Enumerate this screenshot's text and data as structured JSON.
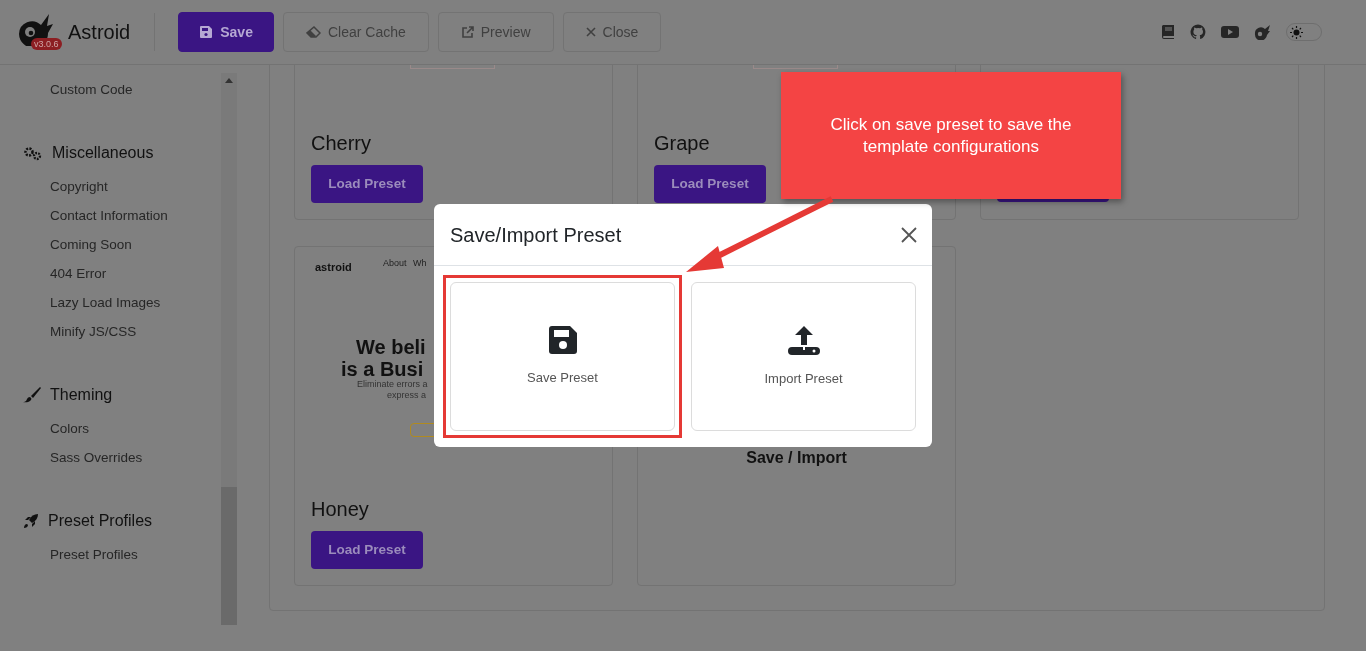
{
  "header": {
    "logo_text": "Astroid",
    "version": "v3.0.6",
    "buttons": [
      {
        "label": "Save",
        "kind": "primary"
      },
      {
        "label": "Clear Cache",
        "kind": "default"
      },
      {
        "label": "Preview",
        "kind": "default"
      },
      {
        "label": "Close",
        "kind": "default"
      }
    ],
    "theme_toggle": {
      "on": false
    }
  },
  "sidebar": {
    "groups": [
      {
        "items": [
          "Custom Code"
        ]
      },
      {
        "title": "Miscellaneous",
        "items": [
          "Copyright",
          "Contact Information",
          "Coming Soon",
          "404 Error",
          "Lazy Load Images",
          "Minify JS/CSS"
        ]
      },
      {
        "title": "Theming",
        "items": [
          "Colors",
          "Sass Overrides"
        ]
      },
      {
        "title": "Preset Profiles",
        "items": [
          "Preset Profiles"
        ]
      }
    ]
  },
  "presets": [
    {
      "kind": "preset",
      "title": "Cherry",
      "button": "Load Preset"
    },
    {
      "kind": "preset",
      "title": "Grape",
      "button": "Load Preset"
    },
    {
      "kind": "covered"
    },
    {
      "kind": "preset",
      "title": "Honey",
      "button": "Load Preset",
      "thumbnail": {
        "logo": "astroid",
        "nav": [
          "About",
          "Wh"
        ],
        "headline": [
          "We beli",
          "is a Busi"
        ],
        "tagline": [
          "Eliminate errors a",
          "express a"
        ]
      }
    },
    {
      "kind": "caption",
      "caption": "Save / Import"
    }
  ],
  "modal": {
    "title": "Save/Import Preset",
    "options": [
      {
        "label": "Save Preset",
        "highlighted": true
      },
      {
        "label": "Import Preset",
        "highlighted": false
      }
    ]
  },
  "callout": {
    "text": "Click on save preset to save the template configurations"
  }
}
